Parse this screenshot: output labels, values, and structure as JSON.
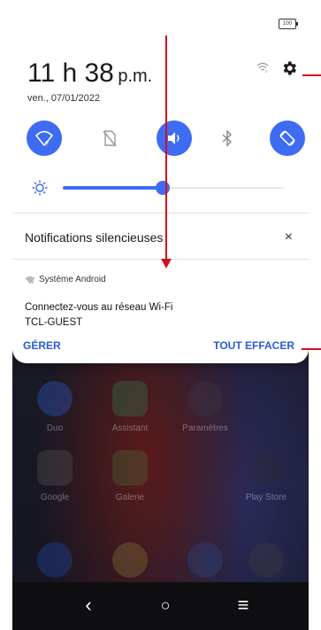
{
  "status": {
    "battery": "100"
  },
  "header": {
    "time": "11 h 38",
    "ampm": "p.m.",
    "date": "ven., 07/01/2022"
  },
  "quick_settings": [
    {
      "name": "wifi",
      "state": "on"
    },
    {
      "name": "sim",
      "state": "off"
    },
    {
      "name": "sound",
      "state": "on"
    },
    {
      "name": "bluetooth",
      "state": "off"
    },
    {
      "name": "auto-rotate",
      "state": "on"
    }
  ],
  "brightness": {
    "level": 0.45
  },
  "notifications": {
    "section_title": "Notifications silencieuses",
    "close_icon": "×",
    "items": [
      {
        "app": "Système Android",
        "title": "Connectez-vous au réseau Wi-Fi",
        "text": "TCL-GUEST"
      }
    ],
    "manage_label": "GÉRER",
    "clear_all_label": "TOUT EFFACER"
  },
  "home_apps": [
    "Duo",
    "Assistant",
    "Paramètres",
    "Google",
    "Galerie",
    "Play Store"
  ],
  "navbar": {
    "back": "‹",
    "home": "○",
    "menu": "≡"
  },
  "colors": {
    "accent": "#3d6cf3",
    "action_text": "#2a5bd8",
    "annotation": "#d01020"
  }
}
